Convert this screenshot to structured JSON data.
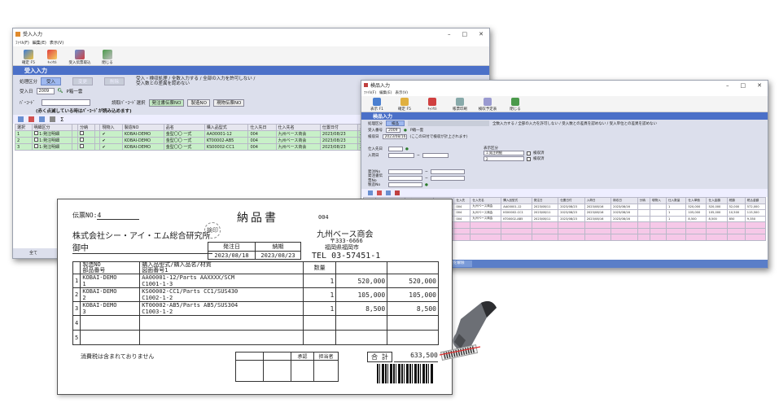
{
  "win1": {
    "title": "受入入力",
    "menu": [
      "ﾌｧｲﾙ(F)",
      "編集(E)",
      "表示(V)"
    ],
    "toolbar": [
      "確定 F5",
      "ｷｬﾝｾﾙ",
      "受入伝票取込",
      "閉じる"
    ],
    "banner": "受入入力",
    "kubun_label": "処理区分",
    "kubun_btns": [
      "受入",
      "変更",
      "削除"
    ],
    "note": "受入・検収処理 / 全数入力する / 全部の入力を許可しない / 受入数との差異を認めない",
    "ukeirebi_label": "受入日",
    "ukeirebi": "2009",
    "tanto": "P箱一雲",
    "barcode_label": "ﾊﾞｰｺｰﾄﾞ",
    "scan_label": "読取ﾊﾞｰｺｰﾄﾞ選択",
    "scan_opts": [
      "発注書伝票NO",
      "製造NO",
      "現物伝票NO"
    ],
    "hint": "(赤く点滅している時はﾊﾞｰｺｰﾄﾞが読み込めます)",
    "headers": [
      "選択",
      "明細区分",
      "",
      "分納",
      "",
      "現物入",
      "製造NO",
      "品名",
      "購入品型式",
      "仕入先日",
      "仕入先名",
      "仕置日付",
      "入"
    ],
    "rows": [
      [
        "1",
        "",
        "1:発注明細",
        "",
        "",
        "",
        "KOBAI-DEMO",
        "金型〇〇 一式",
        "AA00001-12",
        "004",
        "九州ベース商会",
        "2023/08/23",
        "2("
      ],
      [
        "2",
        "",
        "1:発注明細",
        "",
        "",
        "",
        "KOBAI-DEMO",
        "金型〇〇 一式",
        "KT00002-AB5",
        "004",
        "九州ベース商会",
        "2023/08/23",
        "2("
      ],
      [
        "3",
        "",
        "1:発注明細",
        "",
        "",
        "",
        "KOBAI-DEMO",
        "金型〇〇 一式",
        "KS00002-CC1",
        "004",
        "九州ベース商会",
        "2023/08/23",
        "2("
      ]
    ],
    "footer_btn": "全て"
  },
  "win2": {
    "title": "検品入力",
    "menu": [
      "ﾌｧｲﾙ(F)",
      "編集(E)",
      "表示(V)"
    ],
    "toolbar": [
      "表示 F1",
      "確定 F5",
      "ｷｬﾝｾﾙ",
      "帳票印刷",
      "検収予定表",
      "閉じる"
    ],
    "banner": "検品入力",
    "kubun_label": "処理区分",
    "kubun_btns": [
      "検品"
    ],
    "note": "全数入力する / 全部の入力を許可しない / 受入数との差異を認めない / 受入単位との差異を認めない",
    "kenpin_label": "受入番号",
    "kenpin_val": "2009",
    "tanto": "P箱一雲",
    "date_label": "検収日",
    "date_val": "2023/08/16",
    "date_note": "(ここの日付で検収が計上されます)",
    "fields": [
      "仕入先日",
      "入荷日",
      "発注No",
      "発注書伝票No",
      "製造No"
    ],
    "disp_label": "表示区分",
    "disp_opts": [
      "1:発注明細",
      "2"
    ],
    "chk_labels": [
      "検収済",
      "検収済"
    ],
    "headers": [
      "選択",
      "明細NO",
      "品名",
      "製造NO",
      "仕入先",
      "仕入先名",
      "購入品型式",
      "発注日",
      "仕置日付",
      "入荷日",
      "検収日",
      "分納",
      "現物入",
      "仕入数量",
      "仕入単価",
      "仕入金額",
      "税額",
      "税込金額"
    ],
    "rows": [
      [
        "1",
        "",
        "KOBAI-DEMO",
        "金型〇〇 一式",
        "BUHIN-1",
        "004",
        "九州ベース商会",
        "AA00001-12",
        "2023/08/11",
        "2023/08/23",
        "2023/08/16",
        "2023/08/16",
        "",
        "",
        "1",
        "520,000",
        "520,000",
        "52,000",
        "572,000"
      ],
      [
        "2",
        "",
        "KOBAI-DEMO",
        "金型〇〇 一式",
        "BUHIN-2",
        "004",
        "九州ベース商会",
        "KS00002-CC1",
        "2023/08/11",
        "2023/08/23",
        "2023/08/16",
        "2023/08/16",
        "",
        "",
        "1",
        "105,000",
        "105,000",
        "10,500",
        "115,500"
      ],
      [
        "3",
        "",
        "KOBAI-DEMO",
        "金型〇〇 一式",
        "BUHIN-3",
        "004",
        "九州ベース商会",
        "KT00002-AB5",
        "2023/08/11",
        "2023/08/23",
        "2023/08/16",
        "2023/08/16",
        "",
        "",
        "1",
        "8,500",
        "8,500",
        "850",
        "9,350"
      ],
      [
        "4",
        "",
        "*合計*仕入",
        "",
        "",
        "",
        "",
        "",
        "",
        "",
        "",
        "",
        "",
        "",
        "",
        "",
        "",
        "",
        ""
      ],
      [
        "5",
        "",
        "*合計(税込)*",
        "",
        "",
        "",
        "",
        "",
        "",
        "",
        "",
        "",
        "",
        "",
        "",
        "",
        "",
        "",
        ""
      ],
      [
        "6",
        "",
        "*合計金額*",
        "",
        "",
        "",
        "",
        "",
        "",
        "",
        "",
        "",
        "",
        "",
        "",
        "",
        "",
        "",
        ""
      ]
    ],
    "footer_btns": [
      "全て選択",
      "全ての選択を解除"
    ]
  },
  "slip": {
    "denpyo_label": "伝票NO:",
    "denpyo_no": "4",
    "title": "納品書",
    "code": "004",
    "company": "株式会社シー・アイ・エム総合研究所",
    "honorific": "御中",
    "seal": "検印",
    "vendor": "九州ベース商会",
    "zip": "〒333-6666",
    "address": "福岡県福岡市",
    "tel": "TEL 03-57451-1",
    "hakkobi_label": "発注日",
    "hakkobi": "2023/08/18",
    "noki_label": "納期",
    "noki": "2023/08/23",
    "col_header1": "製造NO",
    "col_header2": "部品番号",
    "col_header3": "購入品型式/購入品名/材質",
    "col_header4": "図面番号1",
    "qty_header": "数量",
    "items": [
      {
        "no": "1",
        "seizo": "KOBAI-DEMO",
        "buhin": "1",
        "kata": "AA00001-12/Parts AAXXXX/SCM",
        "zumen": "C1001-1-3",
        "qty": "1",
        "tanka": "520,000",
        "kingaku": "520,000"
      },
      {
        "no": "2",
        "seizo": "KOBAI-DEMO",
        "buhin": "2",
        "kata": "KS00002-CC1/Parts CC1/SUS430",
        "zumen": "C1002-1-2",
        "qty": "1",
        "tanka": "105,000",
        "kingaku": "105,000"
      },
      {
        "no": "3",
        "seizo": "KOBAI-DEMO",
        "buhin": "3",
        "kata": "KT00002-AB5/Parts AB5/SUS304",
        "zumen": "C1003-1-2",
        "qty": "1",
        "tanka": "8,500",
        "kingaku": "8,500"
      },
      {
        "no": "4",
        "seizo": "",
        "buhin": "",
        "kata": "",
        "zumen": "",
        "qty": "",
        "tanka": "",
        "kingaku": ""
      },
      {
        "no": "5",
        "seizo": "",
        "buhin": "",
        "kata": "",
        "zumen": "",
        "qty": "",
        "tanka": "",
        "kingaku": ""
      }
    ],
    "tax_note": "消費税は含まれておりません",
    "shonin": "承認",
    "tantosha": "担当者",
    "gokei_label": "合 計",
    "gokei": "633,500"
  },
  "colors": {
    "accent": "#4b70c8",
    "form_bg": "#dcdfec",
    "row_hl": "#c8f0c8",
    "row_pink": "#f6c8e8"
  }
}
